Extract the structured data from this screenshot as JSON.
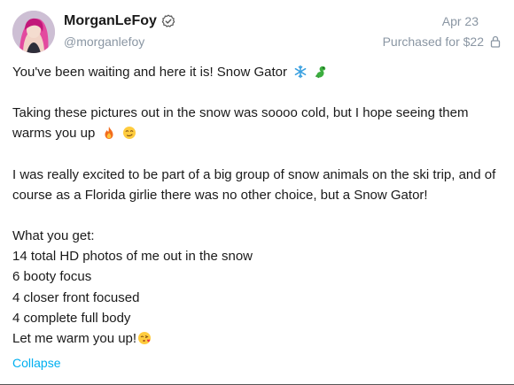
{
  "post": {
    "author": {
      "display_name": "MorganLeFoy",
      "handle": "@morganlefoy",
      "verified_icon": "verified-badge-icon",
      "avatar_icon": "avatar"
    },
    "date": "Apr 23",
    "purchased_label": "Purchased for $22",
    "purchased_icon": "lock-icon",
    "text": {
      "line1": "You've been waiting and here it is! Snow Gator",
      "line1_icons": [
        "snowflake-icon",
        "dragon-icon"
      ],
      "para2": "Taking these pictures out in the snow was soooo cold, but I hope seeing them warms you up",
      "para2_icons": [
        "fire-icon",
        "smirk-face-icon"
      ],
      "para3": "I was really excited to be part of a big group of snow animals on the ski trip, and of course as a Florida girlie there was no other choice, but a Snow Gator!",
      "list_title": "What you get:",
      "list_items": [
        "14 total HD photos of me out in the snow",
        "6 booty focus",
        "4 closer front focused",
        "4 complete full body"
      ],
      "closing": "Let me warm you up!",
      "closing_icon": "kiss-face-icon"
    },
    "collapse_label": "Collapse"
  },
  "colors": {
    "accent": "#00aff0",
    "muted": "#8a96a3",
    "text": "#1a1a1a"
  }
}
